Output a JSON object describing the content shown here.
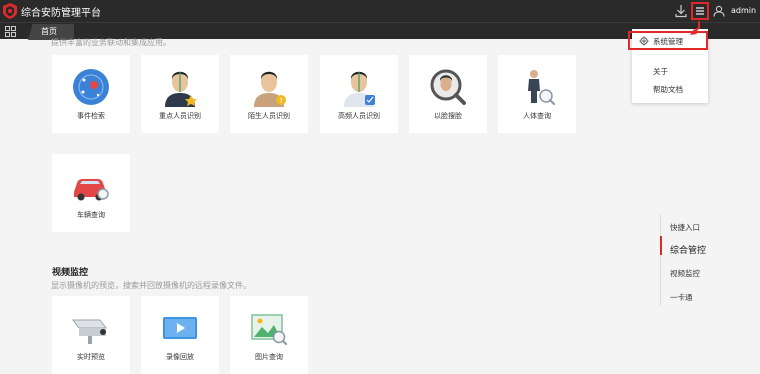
{
  "app": {
    "title": "综合安防管理平台",
    "username": "admin"
  },
  "tabs": [
    {
      "label": "首页"
    }
  ],
  "sections": [
    {
      "description": "提供丰富的业务联动和集成应用。",
      "cards": [
        {
          "label": "事件检索",
          "icon": "event-search-icon"
        },
        {
          "label": "重点人员识别",
          "icon": "key-person-recognition-icon"
        },
        {
          "label": "陌生人员识别",
          "icon": "stranger-recognition-icon"
        },
        {
          "label": "高频人员识别",
          "icon": "frequent-person-recognition-icon"
        },
        {
          "label": "以脸搜脸",
          "icon": "face-search-icon"
        },
        {
          "label": "人体查询",
          "icon": "body-search-icon"
        },
        {
          "label": "车辆查询",
          "icon": "vehicle-search-icon"
        }
      ]
    },
    {
      "title": "视频监控",
      "description": "显示摄像机的预览，搜索并回放摄像机的远程录像文件。",
      "cards": [
        {
          "label": "实时预览",
          "icon": "camera-live-icon"
        },
        {
          "label": "录像回放",
          "icon": "video-playback-icon"
        },
        {
          "label": "图片查询",
          "icon": "image-search-icon"
        }
      ]
    }
  ],
  "dropdown": {
    "items": [
      {
        "label": "系统管理",
        "icon": "gear-icon"
      },
      {
        "label": "关于"
      },
      {
        "label": "帮助文档"
      }
    ]
  },
  "quick_nav": {
    "items": [
      {
        "label": "快捷入口"
      },
      {
        "label": "综合管控",
        "active": true
      },
      {
        "label": "视频监控"
      },
      {
        "label": "一卡通"
      }
    ]
  },
  "colors": {
    "topbar": "#2a2a2a",
    "accent": "#e02a2a",
    "background": "#f4f4f4"
  }
}
